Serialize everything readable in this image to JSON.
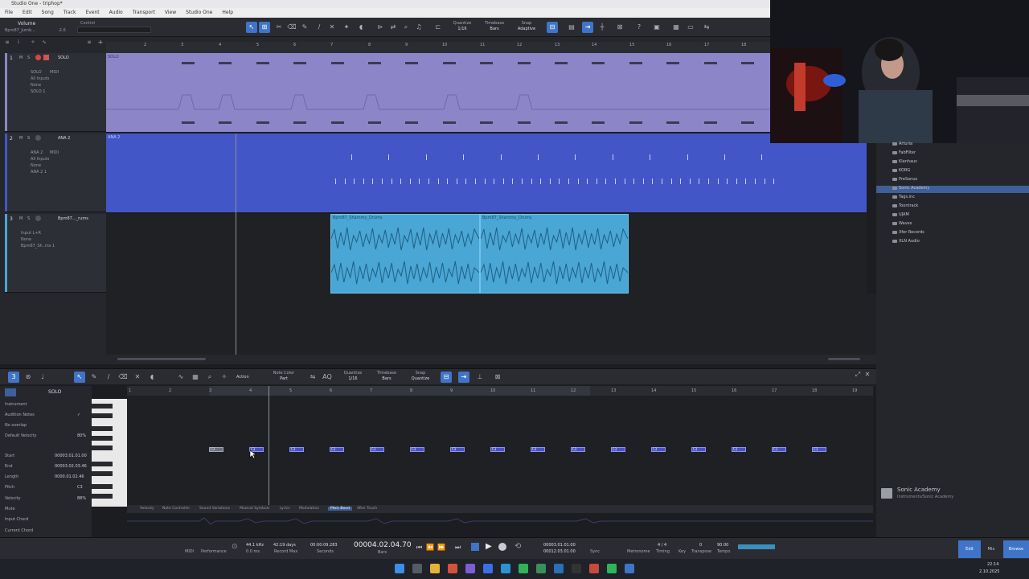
{
  "window": {
    "title": "Studio One - triphop*"
  },
  "menu": [
    "File",
    "Edit",
    "Song",
    "Track",
    "Event",
    "Audio",
    "Transport",
    "View",
    "Studio One",
    "Help"
  ],
  "toolbar": {
    "volume_label": "Volume",
    "control_label": "Control",
    "track_name": "Bpm87_Jumb...",
    "volume_value": "-2.6",
    "quantize_label": "Quantize",
    "quantize_value": "1/16",
    "timebase_label": "Timebase",
    "timebase_value": "Bars",
    "snap_label": "Snap",
    "snap_value": "Adaptive"
  },
  "ruler_numbers": [
    "2",
    "3",
    "4",
    "5",
    "6",
    "7",
    "8",
    "9",
    "10",
    "11",
    "12",
    "13",
    "14",
    "15",
    "16",
    "17",
    "18"
  ],
  "tracks": [
    {
      "num": "1",
      "name": "SOLO",
      "io": [
        "SOLO",
        "All Inputs",
        "None",
        "SOLO 1"
      ],
      "midi": "MIDI",
      "lane_label": "SOLO",
      "color": "#8c86c9"
    },
    {
      "num": "2",
      "name": "ANA 2",
      "io": [
        "ANA 2",
        "All Inputs",
        "None",
        "ANA 2 1"
      ],
      "midi": "MIDI",
      "lane_label": "ANA 2",
      "color": "#4356c7"
    },
    {
      "num": "3",
      "name": "Bpm87..._rums",
      "io": [
        "Input L+R",
        "None",
        "Bpm87_Sh..ms 1"
      ],
      "midi": "",
      "lane_label": "",
      "color": "#4aa6d4"
    }
  ],
  "audio_clips": [
    {
      "title": "Bpm87_Shammy_Drums"
    },
    {
      "title": "Bpm87_Shammy_Drums"
    }
  ],
  "browser": {
    "items": [
      "Arturia",
      "FabFilter",
      "Klanhaus",
      "KORG",
      "PreSonus",
      "Sonic Academy",
      "Tags.inc",
      "Toontrack",
      "UJAM",
      "Waves",
      "Xfer Records",
      "XLN Audio"
    ],
    "selected": "Sonic Academy",
    "footer_title": "Sonic Academy",
    "footer_path": "Instruments/Sonic Academy"
  },
  "editor": {
    "track_name": "SOLO",
    "action_label": "Action",
    "note_color_label": "Note Color",
    "note_color_value": "Part",
    "quantize_label": "Quantize",
    "quantize_value": "1/16",
    "timebase_label": "Timebase",
    "timebase_value": "Bars",
    "snap_label": "Snap",
    "snap_value": "Quantize",
    "inspector": [
      {
        "label": "Instrument",
        "value": ""
      },
      {
        "label": "Audition Notes",
        "value": "✓"
      },
      {
        "label": "No overlap",
        "value": ""
      },
      {
        "label": "Default Velocity",
        "value": "80%"
      },
      {
        "label": "Start",
        "value": "00003.01.01.00"
      },
      {
        "label": "End",
        "value": "00003.02.03.46"
      },
      {
        "label": "Length",
        "value": "0000.01.02.46"
      },
      {
        "label": "Pitch",
        "value": "C3"
      },
      {
        "label": "Velocity",
        "value": "88%"
      },
      {
        "label": "Mute",
        "value": ""
      },
      {
        "label": "Input Chord",
        "value": ""
      },
      {
        "label": "Current Chord",
        "value": ""
      }
    ],
    "ruler_numbers": [
      "1",
      "2",
      "3",
      "4",
      "5",
      "6",
      "7",
      "8",
      "9",
      "10",
      "11",
      "12",
      "13",
      "14",
      "15",
      "16",
      "17",
      "18",
      "19"
    ],
    "note_label": "C3",
    "auto_tabs": [
      "Velocity",
      "Note Controller",
      "Sound Variations",
      "Musical Symbols",
      "Lyrics",
      "Modulation",
      "Pitch Bend",
      "After Touch"
    ],
    "auto_active": "Pitch Bend"
  },
  "transport": {
    "midi_label": "MIDI",
    "performance_label": "Performance",
    "sample_rate": "44.1 kHz",
    "latency": "0.0 ms",
    "record_days": "42:19 days",
    "record_max": "Record Max",
    "seconds_value": "00:00:09.283",
    "seconds_label": "Seconds",
    "position": "00004.02.04.70",
    "position_label": "Bars",
    "loop_start": "00003.01.01.00",
    "loop_end": "00012.03.01.00",
    "sync_label": "Sync",
    "metronome_label": "Metronome",
    "timing_value": "4 / 4",
    "timing_label": "Timing",
    "key_label": "Key",
    "transpose_value": "0",
    "transpose_label": "Transpose",
    "tempo_value": "90.00",
    "tempo_label": "Tempo",
    "edit_btn": "Edit",
    "mix_btn": "Mix",
    "browse_btn": "Browse"
  },
  "clock": {
    "time": "22:14",
    "date": "2.10.2025"
  },
  "colors": {
    "accent": "#3f74c8",
    "solo_track": "#8c86c9",
    "ana_track": "#4356c7",
    "audio_clip": "#4aa6d4",
    "note": "#4b52c7"
  }
}
